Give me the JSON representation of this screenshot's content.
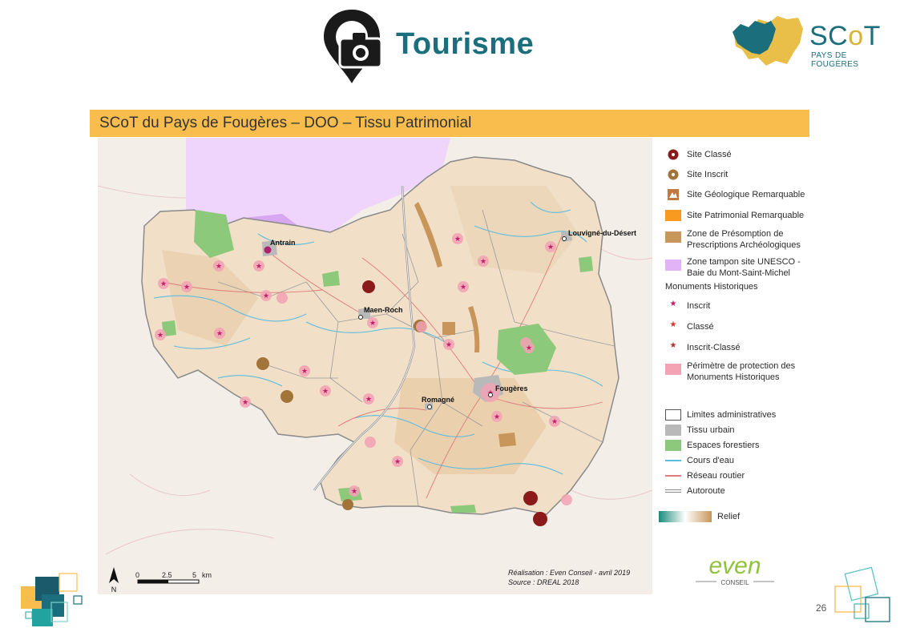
{
  "header": {
    "title": "Tourisme",
    "brand_name_start": "SC",
    "brand_name_accent": "o",
    "brand_name_end": "T",
    "brand_subtitle": "PAYS DE FOUGÈRES"
  },
  "band": {
    "title": "SCoT du Pays de Fougères – DOO – Tissu Patrimonial"
  },
  "map": {
    "towns": [
      "Antrain",
      "Louvigné-du-Désert",
      "Maen-Roch",
      "Romagné",
      "Fougères"
    ],
    "north_label": "N",
    "scale": {
      "zero": "0",
      "mid": "2.5",
      "end": "5",
      "unit": "km"
    },
    "credit_line1": "Réalisation : Even Conseil - avril 2019",
    "credit_line2": "Source : DREAL 2018"
  },
  "legend": {
    "site_classe": "Site Classé",
    "site_inscrit": "Site Inscrit",
    "site_geologique": "Site Géologique Remarquable",
    "site_patrimonial": "Site Patrimonial Remarquable",
    "zone_presomption_1": "Zone de Présomption de",
    "zone_presomption_2": "Prescriptions Archéologiques",
    "zone_unesco_1": "Zone tampon site UNESCO -",
    "zone_unesco_2": "Baie du Mont-Saint-Michel",
    "monuments_heading": "Monuments Historiques",
    "inscrit": "Inscrit",
    "classe": "Classé",
    "inscrit_classe": "Inscrit-Classé",
    "perimetre_1": "Périmètre de protection des",
    "perimetre_2": "Monuments Historiques",
    "limites": "Limites administratives",
    "tissu_urbain": "Tissu urbain",
    "espaces_forestiers": "Espaces forestiers",
    "cours_eau": "Cours d'eau",
    "reseau_routier": "Réseau routier",
    "autoroute": "Autoroute",
    "relief": "Relief"
  },
  "footer": {
    "logo_text": "even",
    "logo_sub": "CONSEIL",
    "page_number": "26"
  },
  "colors": {
    "title_teal": "#1b6f7d",
    "band_orange": "#f8bd4d",
    "unesco_purple": "#e3b3f7",
    "forest_green": "#8cc97a",
    "water_blue": "#5bbde0",
    "road_red": "#e07a7a",
    "heritage_pink": "#f3a3b4",
    "archaeo_brown": "#c8965a",
    "even_green": "#8fc33a"
  }
}
